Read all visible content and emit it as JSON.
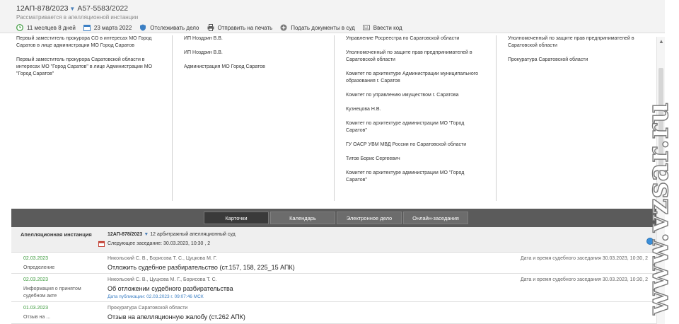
{
  "header": {
    "case_number": "12АП-878/2023",
    "alt_case_number": "А57-5583/2022",
    "subtitle": "Рассматривается в апелляционной инстанции",
    "toolbar": [
      {
        "icon": "clock-icon",
        "label": "11 месяцев 8 дней"
      },
      {
        "icon": "calendar-icon",
        "label": "23 марта 2022"
      },
      {
        "icon": "shield-icon",
        "label": "Отслеживать дело"
      },
      {
        "icon": "printer-icon",
        "label": "Отправить на печать"
      },
      {
        "icon": "submit-icon",
        "label": "Подать документы в суд"
      },
      {
        "icon": "code-icon",
        "label": "Ввести код"
      }
    ]
  },
  "parties": {
    "plaintiffs": [
      "Первый заместитель прокурора СО в интересах МО Город Саратов в лице администрации МО Город Саратов",
      "Первый заместитель прокурора Саратовской области в интересах МО \"Город Саратов\" в лице Администрации МО \"Город Саратов\""
    ],
    "defendants": [
      "ИП Ноздрин В.В.",
      "ИП Ноздрин В.В.",
      "Администрация МО Город Саратов"
    ],
    "third_parties": [
      "Управление Росреестра по Саратовской области",
      "Уполномоченный по защите прав предпринимателей в Саратовской области",
      "Комитет по архитектуре Администрации муниципального образования г. Саратов",
      "Комитет по управлению имуществом г. Саратова",
      "Кузнецова Н.В.",
      "Комитет по архитектуре администрации МО \"Город Саратов\"",
      "ГУ ОАСР УВМ МВД России по Саратовской области",
      "Титов Борис Сергеевич",
      "Комитет по архитектуре администрации МО \"Город Саратов\""
    ],
    "others": [
      "Уполномоченный по защите прав предпринимателей в Саратовской области",
      "Прокуратура Саратовской области"
    ]
  },
  "tabs": [
    {
      "label": "Карточки",
      "active": true
    },
    {
      "label": "Календарь",
      "active": false
    },
    {
      "label": "Электронное дело",
      "active": false
    },
    {
      "label": "Онлайн-заседания",
      "active": false
    }
  ],
  "instance": {
    "label": "Апелляционная инстанция",
    "case_number": "12АП-878/2023",
    "court": "12 арбитражный апелляционный суд",
    "next_session": "Следующее заседание: 30.03.2023, 10:30 , 2"
  },
  "events": [
    {
      "date": "02.03.2023",
      "type": "Определение",
      "judges": "Никольский С. В., Борисова Т. С., Цуцкова М. Г.",
      "title": "Отложить судебное разбирательство (ст.157, 158, 225_15 АПК)",
      "publication": "",
      "session": "Дата и время судебного заседания 30.03.2023, 10:30, 2"
    },
    {
      "date": "02.03.2023",
      "type": "Информация о принятом судебном акте",
      "judges": "Никольский С. В., Цуцкова М. Г., Борисова Т. С.",
      "title": "Об отложении судебного разбирательства",
      "publication": "Дата публикации: 02.03.2023 г. 09:07:46 МСК",
      "session": "Дата и время судебного заседания 30.03.2023, 10:30, 2"
    },
    {
      "date": "01.03.2023",
      "type": "Отзыв на ...",
      "judges": "Прокуратура Саратовской области",
      "title": "Отзыв на апелляционную жалобу (ст.262 АПК)",
      "publication": "",
      "session": ""
    }
  ],
  "watermark": "www.vzsar.ru",
  "colors": {
    "accent": "#3b7fc4",
    "date_green": "#3c9a3c",
    "tab_band": "#5b5b5b"
  }
}
